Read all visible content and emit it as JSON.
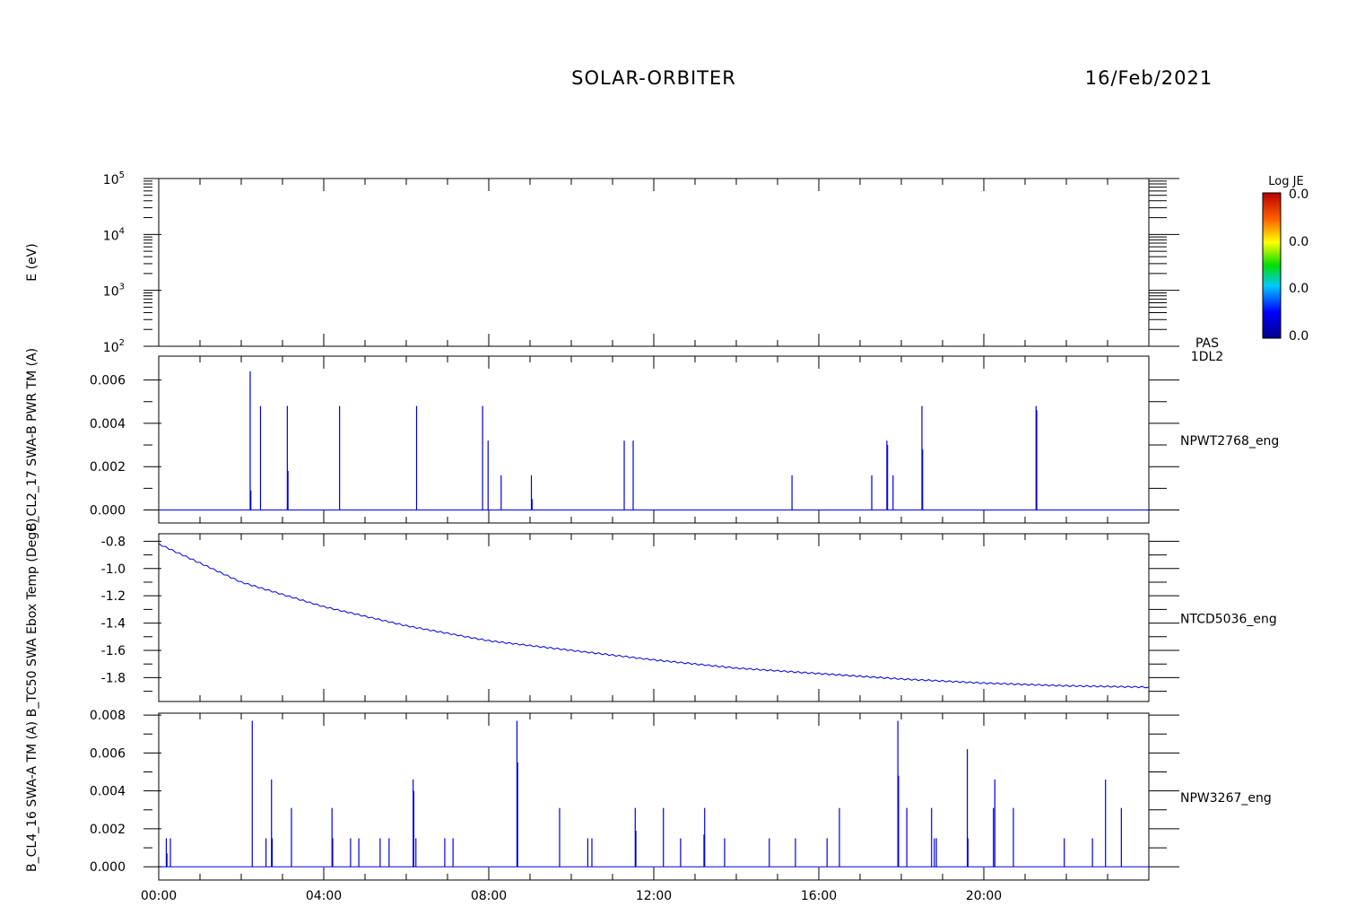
{
  "header": {
    "mission": "SOLAR-ORBITER",
    "date": "16/Feb/2021"
  },
  "colorbar": {
    "title": "Log JE",
    "labels": [
      "0.0",
      "0.0",
      "0.0",
      "0.0"
    ]
  },
  "chart_data": [
    {
      "type": "heatmap",
      "ylabel": "E (eV)",
      "yscale": "log",
      "ylim": [
        100,
        100000
      ],
      "ytick_labels": [
        {
          "base": "10",
          "exp": "5"
        },
        {
          "base": "10",
          "exp": "4"
        },
        {
          "base": "10",
          "exp": "3"
        },
        {
          "base": "10",
          "exp": "2"
        }
      ],
      "panel_label": [
        "PAS",
        "1DL2"
      ],
      "values": []
    },
    {
      "type": "line",
      "ylabel": "B_CL2_17 SWA-B PWR TM (A)",
      "series_label": "NPWT2768_eng",
      "ylim": [
        -0.0006,
        0.0071
      ],
      "yticks": [
        "0.006",
        "0.004",
        "0.002",
        "0.000"
      ],
      "spikes": [
        {
          "t": "02:13",
          "v": 0.0064
        },
        {
          "t": "02:14",
          "v": 0.0009
        },
        {
          "t": "02:28",
          "v": 0.0048
        },
        {
          "t": "03:07",
          "v": 0.0048
        },
        {
          "t": "03:08",
          "v": 0.0018
        },
        {
          "t": "04:23",
          "v": 0.0048
        },
        {
          "t": "06:15",
          "v": 0.0048
        },
        {
          "t": "07:51",
          "v": 0.0048
        },
        {
          "t": "07:59",
          "v": 0.0032
        },
        {
          "t": "08:18",
          "v": 0.0016
        },
        {
          "t": "09:02",
          "v": 0.0016
        },
        {
          "t": "09:03",
          "v": 0.0005
        },
        {
          "t": "11:17",
          "v": 0.0032
        },
        {
          "t": "11:30",
          "v": 0.0032
        },
        {
          "t": "15:21",
          "v": 0.0016
        },
        {
          "t": "17:17",
          "v": 0.0016
        },
        {
          "t": "17:39",
          "v": 0.0032
        },
        {
          "t": "17:40",
          "v": 0.003
        },
        {
          "t": "17:48",
          "v": 0.0016
        },
        {
          "t": "18:30",
          "v": 0.0048
        },
        {
          "t": "18:31",
          "v": 0.0028
        },
        {
          "t": "21:16",
          "v": 0.0048
        },
        {
          "t": "21:17",
          "v": 0.0046
        }
      ]
    },
    {
      "type": "line",
      "ylabel": "B_TC50 SWA Ebox Temp (DegC)",
      "series_label": "NTCD5036_eng",
      "ylim": [
        -1.975,
        -0.745
      ],
      "yticks": [
        "-0.8",
        "-1.0",
        "-1.2",
        "-1.4",
        "-1.6",
        "-1.8"
      ],
      "x": [
        "00:00",
        "02:00",
        "04:00",
        "06:00",
        "08:00",
        "10:00",
        "12:00",
        "14:00",
        "16:00",
        "18:00",
        "20:00",
        "22:00",
        "24:00"
      ],
      "y": [
        -0.82,
        -1.1,
        -1.28,
        -1.42,
        -1.53,
        -1.6,
        -1.67,
        -1.73,
        -1.77,
        -1.81,
        -1.84,
        -1.86,
        -1.87
      ]
    },
    {
      "type": "line",
      "ylabel": "B_CL4_16 SWA-A TM (A)",
      "series_label": "NPW3267_eng",
      "ylim": [
        -0.0007,
        0.0081
      ],
      "yticks": [
        "0.008",
        "0.006",
        "0.004",
        "0.002",
        "0.000"
      ],
      "xticks": [
        "00:00",
        "04:00",
        "08:00",
        "12:00",
        "16:00",
        "20:00"
      ],
      "spikes": [
        {
          "t": "00:11",
          "v": 0.0015
        },
        {
          "t": "00:12",
          "v": 0.0007
        },
        {
          "t": "00:17",
          "v": 0.0015
        },
        {
          "t": "02:16",
          "v": 0.0077
        },
        {
          "t": "02:36",
          "v": 0.0015
        },
        {
          "t": "02:44",
          "v": 0.0046
        },
        {
          "t": "02:45",
          "v": 0.0015
        },
        {
          "t": "03:13",
          "v": 0.0031
        },
        {
          "t": "04:12",
          "v": 0.0031
        },
        {
          "t": "04:13",
          "v": 0.0015
        },
        {
          "t": "04:39",
          "v": 0.0015
        },
        {
          "t": "04:51",
          "v": 0.0015
        },
        {
          "t": "05:22",
          "v": 0.0015
        },
        {
          "t": "05:35",
          "v": 0.0015
        },
        {
          "t": "06:10",
          "v": 0.0046
        },
        {
          "t": "06:11",
          "v": 0.004
        },
        {
          "t": "06:14",
          "v": 0.0015
        },
        {
          "t": "06:56",
          "v": 0.0015
        },
        {
          "t": "07:08",
          "v": 0.0015
        },
        {
          "t": "08:41",
          "v": 0.0077
        },
        {
          "t": "08:42",
          "v": 0.0055
        },
        {
          "t": "09:43",
          "v": 0.0031
        },
        {
          "t": "10:24",
          "v": 0.0015
        },
        {
          "t": "10:30",
          "v": 0.0015
        },
        {
          "t": "11:33",
          "v": 0.0031
        },
        {
          "t": "11:34",
          "v": 0.0019
        },
        {
          "t": "12:14",
          "v": 0.0031
        },
        {
          "t": "12:39",
          "v": 0.0015
        },
        {
          "t": "13:14",
          "v": 0.0031
        },
        {
          "t": "13:13",
          "v": 0.0017
        },
        {
          "t": "13:43",
          "v": 0.0015
        },
        {
          "t": "14:48",
          "v": 0.0015
        },
        {
          "t": "15:26",
          "v": 0.0015
        },
        {
          "t": "16:12",
          "v": 0.0015
        },
        {
          "t": "16:30",
          "v": 0.0031
        },
        {
          "t": "17:55",
          "v": 0.0077
        },
        {
          "t": "17:56",
          "v": 0.0048
        },
        {
          "t": "18:08",
          "v": 0.0031
        },
        {
          "t": "18:44",
          "v": 0.0031
        },
        {
          "t": "18:48",
          "v": 0.0015
        },
        {
          "t": "18:51",
          "v": 0.0015
        },
        {
          "t": "19:36",
          "v": 0.0062
        },
        {
          "t": "19:37",
          "v": 0.0015
        },
        {
          "t": "20:14",
          "v": 0.0031
        },
        {
          "t": "20:16",
          "v": 0.0046
        },
        {
          "t": "20:43",
          "v": 0.0031
        },
        {
          "t": "21:57",
          "v": 0.0015
        },
        {
          "t": "22:38",
          "v": 0.0015
        },
        {
          "t": "22:57",
          "v": 0.0046
        },
        {
          "t": "23:20",
          "v": 0.0031
        }
      ]
    }
  ]
}
